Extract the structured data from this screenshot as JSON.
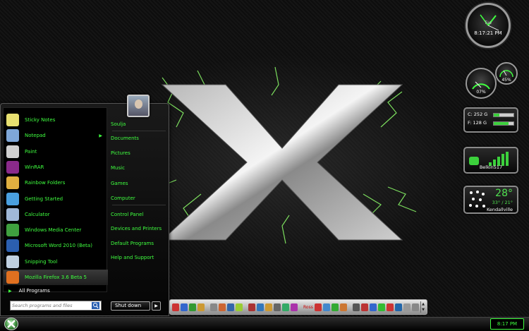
{
  "gadgets": {
    "clock": {
      "day": "Tue",
      "time": "8:17:21 PM"
    },
    "meters": {
      "cpu_label": "07%",
      "mem_label": "45%",
      "cpu_value": 7,
      "mem_value": 45
    },
    "drives": [
      {
        "label": "C: 252 G",
        "used_fraction": 0.3
      },
      {
        "label": "F: 128 G",
        "used_fraction": 0.75
      }
    ],
    "wifi": {
      "network": "Belkin517"
    },
    "weather": {
      "temperature": "28°",
      "range": "33° / 21°",
      "city": "Kendallville"
    }
  },
  "start_menu": {
    "programs": [
      {
        "label": "Sticky Notes",
        "icon": "sticky-notes-icon",
        "color": "#e8e070"
      },
      {
        "label": "Notepad",
        "icon": "notepad-icon",
        "color": "#7fa7d8",
        "has_submenu": true
      },
      {
        "label": "Paint",
        "icon": "paint-icon",
        "color": "#d0d0d0"
      },
      {
        "label": "WinRAR",
        "icon": "winrar-icon",
        "color": "#8a2a8a"
      },
      {
        "label": "Rainbow Folders",
        "icon": "rainbow-folders-icon",
        "color": "#e0b040"
      },
      {
        "label": "Getting Started",
        "icon": "getting-started-icon",
        "color": "#4aa0e0"
      },
      {
        "label": "Calculator",
        "icon": "calculator-icon",
        "color": "#a0b8d8"
      },
      {
        "label": "Windows Media Center",
        "icon": "media-center-icon",
        "color": "#3fa03f"
      },
      {
        "label": "Microsoft Word 2010 (Beta)",
        "icon": "word-icon",
        "color": "#2b5fb0"
      },
      {
        "label": "Snipping Tool",
        "icon": "snipping-tool-icon",
        "color": "#c0d0e0"
      },
      {
        "label": "Mozilla Firefox 3.6 Beta 5",
        "icon": "firefox-icon",
        "color": "#e07020",
        "highlighted": true
      }
    ],
    "all_programs": "All Programs",
    "search_placeholder": "Search programs and files",
    "places": [
      "Soulja",
      "Documents",
      "Pictures",
      "Music",
      "Games",
      "Computer",
      "Control Panel",
      "Devices and Printers",
      "Default Programs",
      "Help and Support"
    ],
    "shutdown_label": "Shut down"
  },
  "dock": {
    "items": [
      "#c33",
      "#36c",
      "#393",
      "#c93",
      "#888",
      "#c63",
      "#36a",
      "#9c3",
      "#a33",
      "#37b",
      "#c93",
      "#666",
      "#3a6",
      "#a3a",
      "#c33",
      "#48c",
      "#3a3",
      "#c73",
      "#555",
      "#b33",
      "#36c",
      "#3b3",
      "#c33",
      "#26a",
      "#999",
      "#888"
    ],
    "text_item": "Ross"
  },
  "taskbar": {
    "time": "8:17 PM"
  },
  "colors": {
    "accent": "#3fff3f",
    "background": "#0d0d0d"
  }
}
